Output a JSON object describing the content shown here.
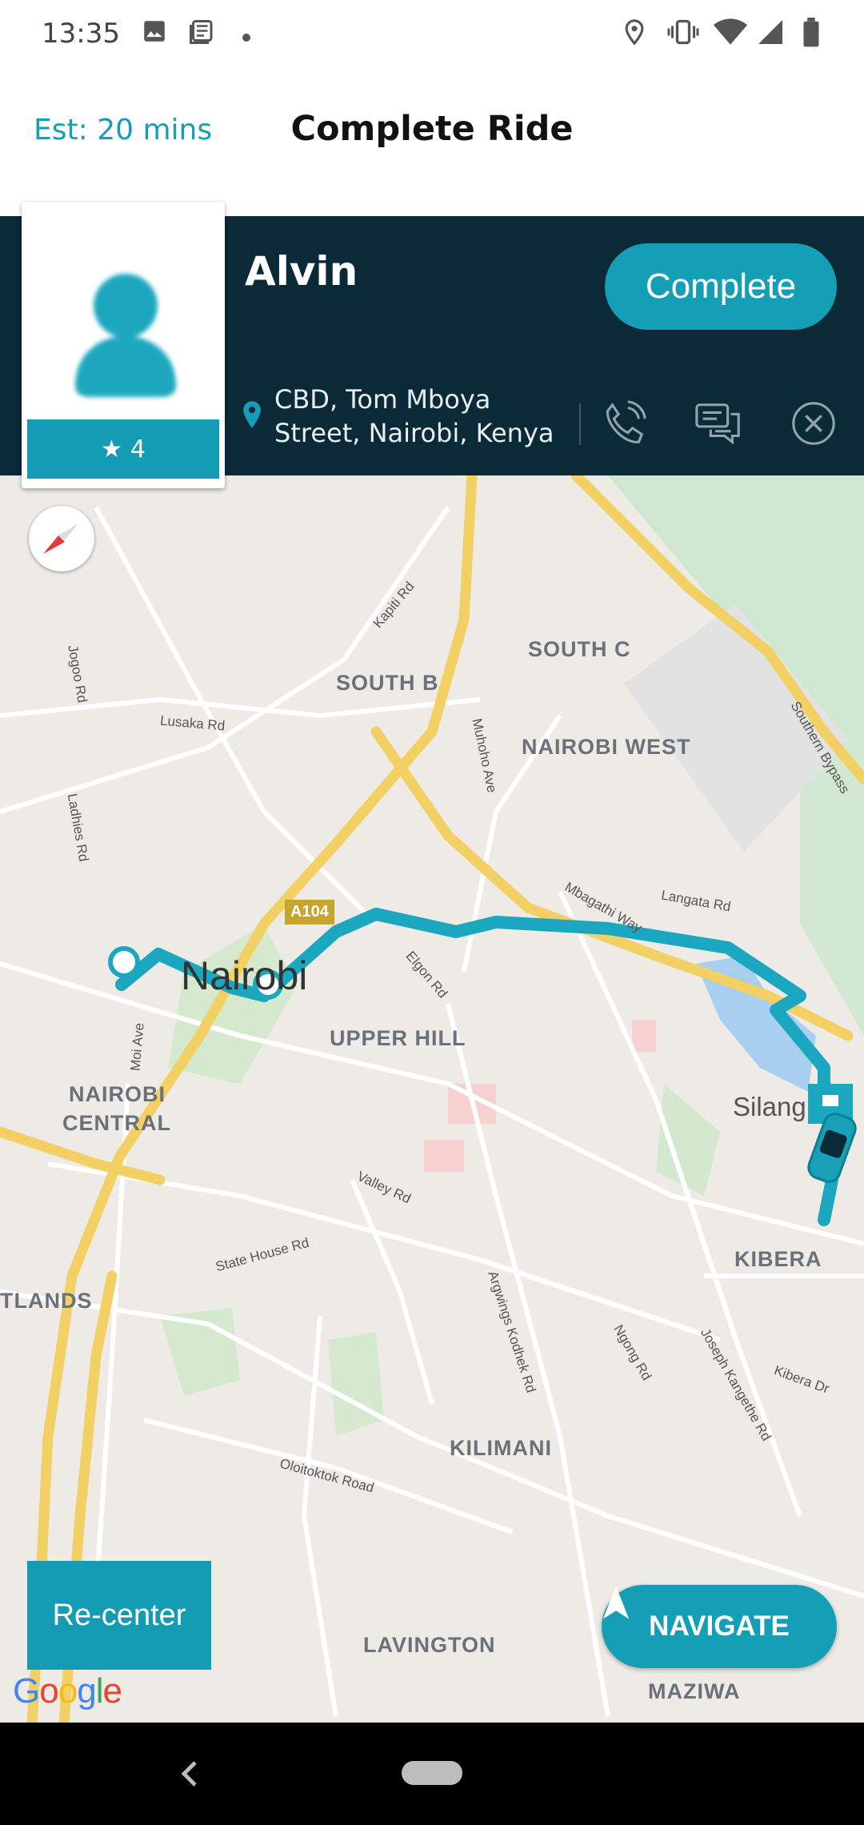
{
  "status_bar": {
    "time": "13:35",
    "left_icons": [
      "image-icon",
      "news-icon",
      "dot-icon"
    ],
    "right_icons": [
      "location-icon",
      "vibrate-icon",
      "wifi-icon",
      "signal-icon",
      "battery-icon"
    ]
  },
  "header": {
    "estimate": "Est: 20 mins",
    "title": "Complete Ride"
  },
  "rider": {
    "name": "Alvin",
    "rating": "4",
    "address": "CBD, Tom Mboya Street, Nairobi, Kenya"
  },
  "actions": {
    "complete_label": "Complete",
    "icons": [
      "phone-icon",
      "chat-icon",
      "cancel-icon"
    ]
  },
  "map": {
    "city_label": "Nairobi",
    "areas": [
      "SOUTH C",
      "SOUTH B",
      "NAIROBI WEST",
      "UPPER HILL",
      "NAIROBI",
      "CENTRAL",
      "KIBERA",
      "TLANDS",
      "KILIMANI",
      "LAVINGTON",
      "MAZIWA"
    ],
    "place": "Silang",
    "roads": [
      "Kapiti Rd",
      "Jogoo Rd",
      "Lusaka Rd",
      "Southern Bypass",
      "Muhoho Ave",
      "Ladhies Rd",
      "Mbagathi Way",
      "Langata Rd",
      "Elgon Rd",
      "Moi Ave",
      "Valley Rd",
      "State House Rd",
      "Argwings Kodhek Rd",
      "Ngong Rd",
      "Joseph Kangethe Rd",
      "Kibera Dr",
      "Oloitoktok Road"
    ],
    "shield": "A104",
    "route_color": "#1aa7bf"
  },
  "controls": {
    "recenter_label": "Re-center",
    "navigate_label": "NAVIGATE",
    "google": "Google"
  },
  "colors": {
    "accent": "#149fb6",
    "panel": "#0a2a37"
  }
}
